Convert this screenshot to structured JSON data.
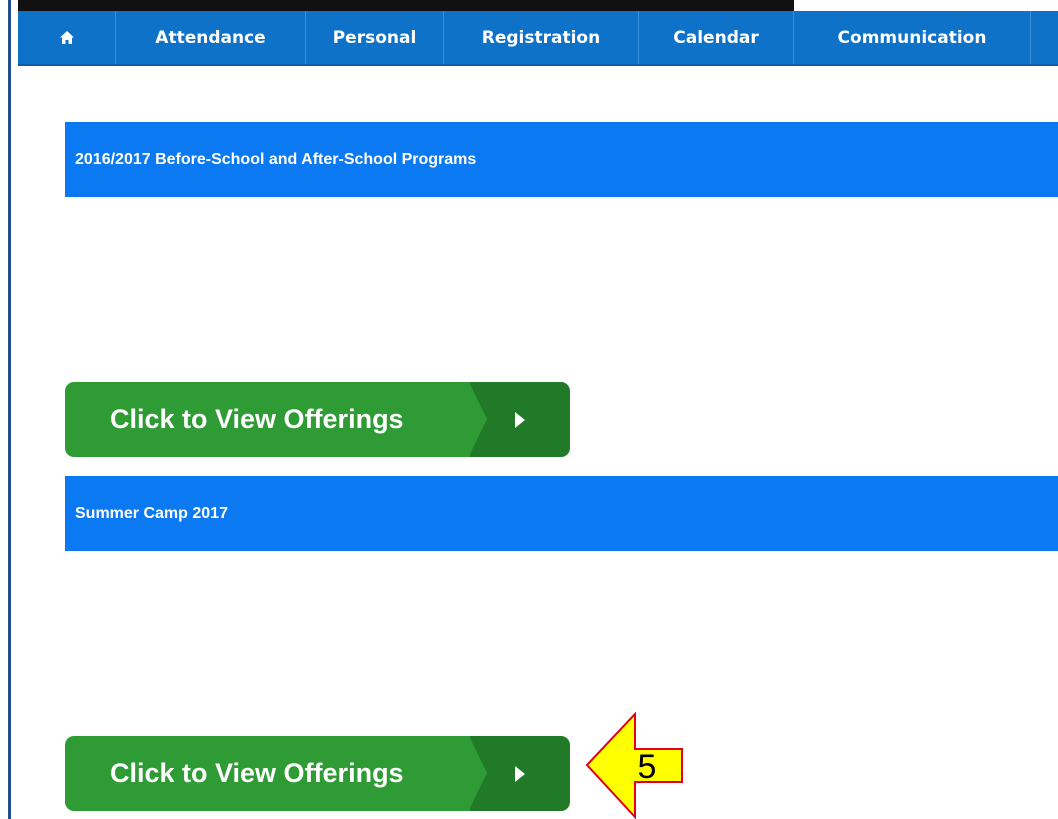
{
  "nav": {
    "home_icon": "home-icon",
    "items": [
      "Attendance",
      "Personal",
      "Registration",
      "Calendar",
      "Communication"
    ]
  },
  "sections": [
    {
      "title": "2016/2017 Before-School and After-School Programs",
      "button_label": "Click to View Offerings",
      "button_icon": "play-arrow-icon"
    },
    {
      "title": "Summer Camp 2017",
      "button_label": "Click to View Offerings",
      "button_icon": "play-arrow-icon"
    }
  ],
  "callout": {
    "number": "5",
    "fill": "#ffff00",
    "stroke": "#e0001b"
  },
  "colors": {
    "nav_bg": "#0f72c9",
    "section_bg": "#0b7af2",
    "button_green": "#2e9b35",
    "button_dark_green": "#217a28"
  }
}
